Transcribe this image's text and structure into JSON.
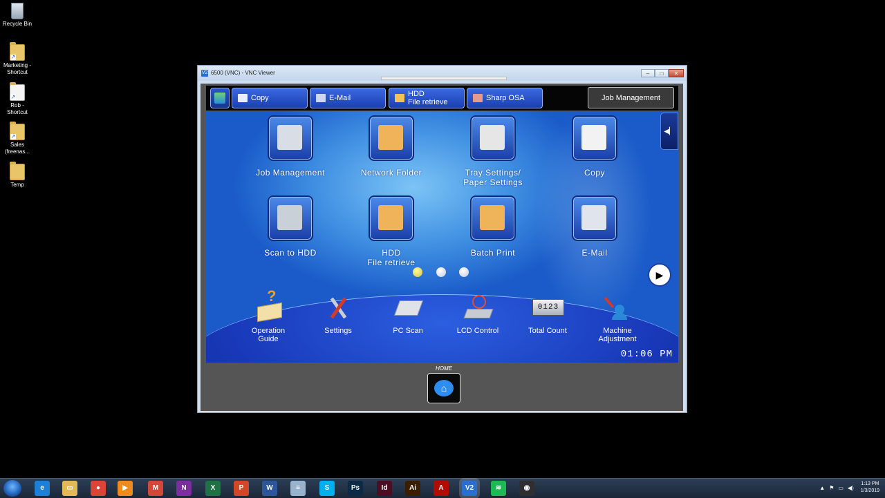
{
  "desktop": {
    "icons": [
      {
        "label": "Recycle Bin"
      },
      {
        "label": "Marketing - Shortcut"
      },
      {
        "label": "Rob - Shortcut"
      },
      {
        "label": "Sales (freenas..."
      },
      {
        "label": "Temp"
      }
    ]
  },
  "window": {
    "title": "6500 (VNC) - VNC Viewer",
    "app_icon": "V2",
    "buttons": {
      "minimize": "–",
      "maximize": "□",
      "close": "✕"
    }
  },
  "tabs": [
    {
      "label": "Copy",
      "icon": "copy-icon",
      "color": "#e8eefc"
    },
    {
      "label": "E-Mail",
      "icon": "email-icon",
      "color": "#cfd8f0"
    },
    {
      "label_line1": "HDD",
      "label_line2": "File retrieve",
      "icon": "hdd-folder-icon",
      "color": "#f1c15a"
    },
    {
      "label": "Sharp OSA",
      "icon": "sharp-osa-icon",
      "color": "#e89a8a"
    }
  ],
  "job_management_button": "Job Management",
  "home_icons": [
    {
      "label": "Job Management",
      "icon": "job-management-icon",
      "color": "#d8dde6"
    },
    {
      "label": "Network Folder",
      "icon": "network-folder-icon",
      "color": "#efb45a"
    },
    {
      "label_line1": "Tray Settings/",
      "label_line2": "Paper Settings",
      "icon": "tray-settings-icon",
      "color": "#e6e6e6"
    },
    {
      "label": "Copy",
      "icon": "copy-icon",
      "color": "#f2f2f2"
    },
    {
      "label": "Scan to HDD",
      "icon": "scan-to-hdd-icon",
      "color": "#c9d0d8"
    },
    {
      "label_line1": "HDD",
      "label_line2": "File retrieve",
      "icon": "hdd-file-retrieve-icon",
      "color": "#efb45a"
    },
    {
      "label": "Batch Print",
      "icon": "batch-print-icon",
      "color": "#efb45a"
    },
    {
      "label": "E-Mail",
      "icon": "email-icon",
      "color": "#e0e4ec"
    }
  ],
  "page_dots": {
    "count": 3,
    "active": 0
  },
  "bottom_icons": [
    {
      "label_line1": "Operation",
      "label_line2": "Guide",
      "icon": "operation-guide-icon"
    },
    {
      "label_line1": "Settings",
      "label_line2": "",
      "icon": "settings-icon"
    },
    {
      "label_line1": "PC Scan",
      "label_line2": "",
      "icon": "pc-scan-icon"
    },
    {
      "label_line1": "LCD Control",
      "label_line2": "",
      "icon": "lcd-control-icon"
    },
    {
      "label_line1": "Total Count",
      "label_line2": "",
      "icon": "total-count-icon",
      "counter": "0123"
    },
    {
      "label_line1": "Machine",
      "label_line2": "Adjustment",
      "icon": "machine-adjustment-icon"
    }
  ],
  "clock": "01:06 PM",
  "home": {
    "label": "HOME"
  },
  "taskbar": {
    "apps": [
      {
        "name": "ie",
        "glyph": "e",
        "color": "#1e7fd6"
      },
      {
        "name": "file-explorer",
        "glyph": "▭",
        "color": "#e3b956"
      },
      {
        "name": "chrome",
        "glyph": "●",
        "color": "#db4437"
      },
      {
        "name": "media-player",
        "glyph": "▶",
        "color": "#f08a1c"
      },
      {
        "name": "gmail",
        "glyph": "M",
        "color": "#d44638"
      },
      {
        "name": "onenote",
        "glyph": "N",
        "color": "#7b2f9e"
      },
      {
        "name": "excel",
        "glyph": "X",
        "color": "#1f7244"
      },
      {
        "name": "powerpoint",
        "glyph": "P",
        "color": "#d24726"
      },
      {
        "name": "word",
        "glyph": "W",
        "color": "#2b579a"
      },
      {
        "name": "notepad",
        "glyph": "≡",
        "color": "#9ab3cc"
      },
      {
        "name": "skype",
        "glyph": "S",
        "color": "#00aff0"
      },
      {
        "name": "photoshop",
        "glyph": "Ps",
        "color": "#0b2a45"
      },
      {
        "name": "indesign",
        "glyph": "Id",
        "color": "#4a0d22"
      },
      {
        "name": "illustrator",
        "glyph": "Ai",
        "color": "#3b1e00"
      },
      {
        "name": "acrobat",
        "glyph": "A",
        "color": "#b30b00"
      },
      {
        "name": "vnc-viewer",
        "glyph": "V2",
        "color": "#2a6ed0"
      },
      {
        "name": "spotify",
        "glyph": "≋",
        "color": "#1db954"
      },
      {
        "name": "obs",
        "glyph": "◉",
        "color": "#302e31"
      }
    ],
    "tray_time": "1:13 PM",
    "tray_date": "1/3/2019"
  }
}
